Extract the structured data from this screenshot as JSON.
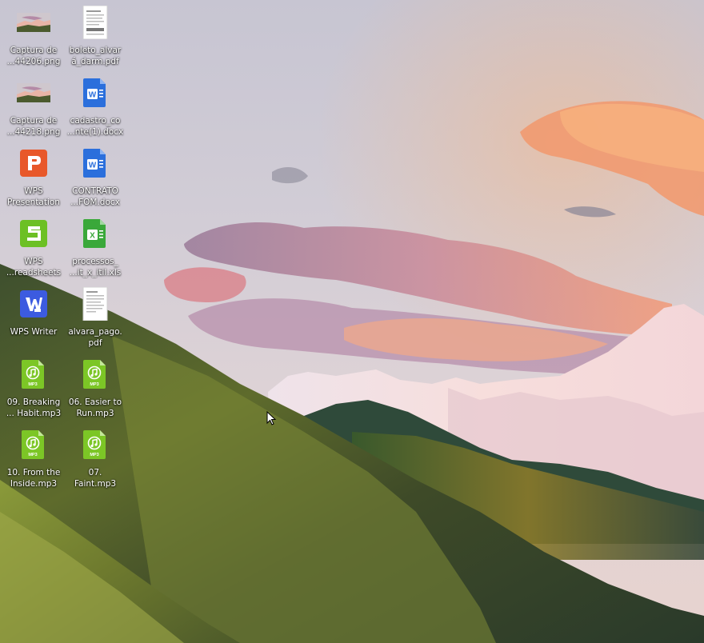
{
  "desktop": {
    "icons": [
      {
        "label": "Captura de\n...44206.png",
        "icon": "image-thumbnail-icon"
      },
      {
        "label": "boleto_alvar\ná_darm.pdf",
        "icon": "pdf-document-icon"
      },
      {
        "label": "Captura de\n...44218.png",
        "icon": "image-thumbnail-icon"
      },
      {
        "label": "cadastro_co\n...nte(1).docx",
        "icon": "word-document-icon"
      },
      {
        "label": "WPS\nPresentation",
        "icon": "wps-presentation-icon"
      },
      {
        "label": "CONTRATO\n...FOM.docx",
        "icon": "word-document-icon"
      },
      {
        "label": "WPS\n...readsheets",
        "icon": "wps-spreadsheets-icon"
      },
      {
        "label": "processos_\n...it_x_itil.xls",
        "icon": "excel-spreadsheet-icon"
      },
      {
        "label": "WPS Writer",
        "icon": "wps-writer-icon"
      },
      {
        "label": "alvara_pago.\npdf",
        "icon": "pdf-document-icon"
      },
      {
        "label": "09. Breaking\n... Habit.mp3",
        "icon": "mp3-audio-icon"
      },
      {
        "label": "06. Easier to\nRun.mp3",
        "icon": "mp3-audio-icon"
      },
      {
        "label": "10. From the\nInside.mp3",
        "icon": "mp3-audio-icon"
      },
      {
        "label": "07.\nFaint.mp3",
        "icon": "mp3-audio-icon"
      }
    ]
  },
  "wallpaper": {
    "description_icon": "mountain-landscape-wallpaper"
  },
  "colors": {
    "word_blue": "#2b6fdc",
    "wps_presentation": "#e8582a",
    "wps_spreadsheets": "#6cc024",
    "excel_green": "#3aa83a",
    "wps_writer": "#3c5be0",
    "mp3_green": "#7cc626"
  },
  "badges": {
    "mp3": "MP3"
  }
}
